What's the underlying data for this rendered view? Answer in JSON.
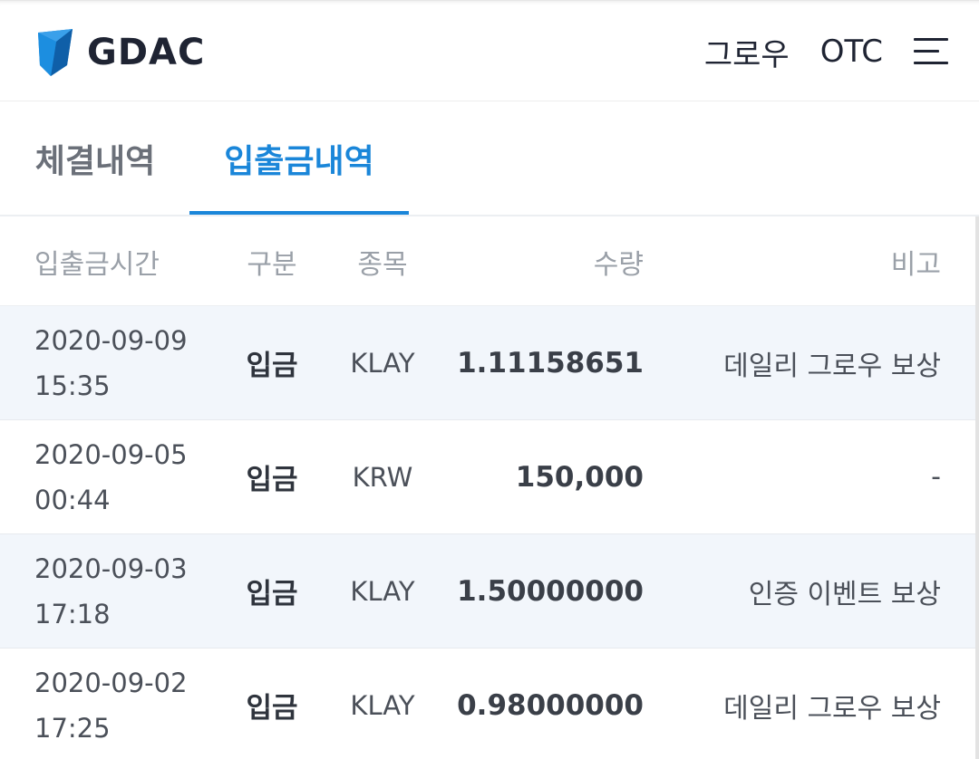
{
  "header": {
    "logo_text": "GDAC",
    "nav": [
      "그로우",
      "OTC"
    ]
  },
  "tabs": [
    {
      "label": "체결내역",
      "active": false
    },
    {
      "label": "입출금내역",
      "active": true
    }
  ],
  "table": {
    "columns": [
      "입출금시간",
      "구분",
      "종목",
      "수량",
      "비고"
    ],
    "rows": [
      {
        "date": "2020-09-09",
        "time": "15:35",
        "type": "입금",
        "coin": "KLAY",
        "amount": "1.11158651",
        "note": "데일리 그로우 보상"
      },
      {
        "date": "2020-09-05",
        "time": "00:44",
        "type": "입금",
        "coin": "KRW",
        "amount": "150,000",
        "note": "-"
      },
      {
        "date": "2020-09-03",
        "time": "17:18",
        "type": "입금",
        "coin": "KLAY",
        "amount": "1.50000000",
        "note": "인증 이벤트 보상"
      },
      {
        "date": "2020-09-02",
        "time": "17:25",
        "type": "입금",
        "coin": "KLAY",
        "amount": "0.98000000",
        "note": "데일리 그로우 보상"
      }
    ]
  },
  "colors": {
    "accent": "#1a86d9",
    "row_shade": "#f2f6fb",
    "logo_blue": "#1a7fd0"
  },
  "icons": [
    "gdac-logo-icon",
    "hamburger-menu-icon"
  ]
}
